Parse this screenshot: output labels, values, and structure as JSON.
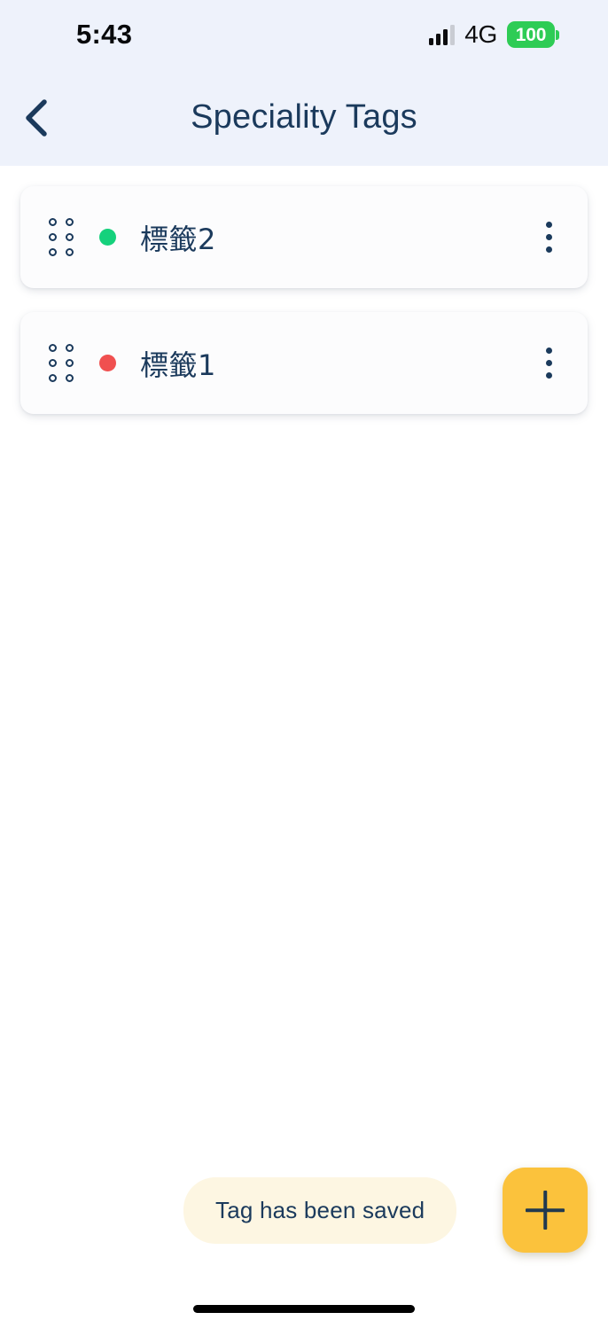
{
  "status_bar": {
    "time": "5:43",
    "network_type": "4G",
    "battery_level": "100",
    "signal_icon": "signal-bars-icon",
    "battery_icon": "battery-icon"
  },
  "nav": {
    "title": "Speciality Tags",
    "back_icon": "chevron-left-icon"
  },
  "tags": [
    {
      "name": "標籤2",
      "color": "#15d17c",
      "drag_icon": "drag-handle-icon",
      "menu_icon": "more-vertical-icon"
    },
    {
      "name": "標籤1",
      "color": "#f05050",
      "drag_icon": "drag-handle-icon",
      "menu_icon": "more-vertical-icon"
    }
  ],
  "toast": {
    "message": "Tag has been saved"
  },
  "fab": {
    "icon": "plus-icon",
    "label": "+"
  },
  "theme": {
    "header_bg": "#eef2fb",
    "page_bg": "#ffffff",
    "card_bg": "#fcfcfd",
    "primary_text": "#1b3a5c",
    "accent": "#fbc23c",
    "toast_bg": "#fdf6e2",
    "battery_green": "#2ecc55"
  }
}
